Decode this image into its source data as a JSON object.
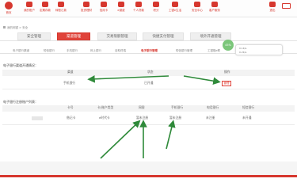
{
  "topnav": {
    "items": [
      {
        "label": "首页",
        "icon": "home-icon"
      },
      {
        "label": "我的账户",
        "icon": "account-icon"
      },
      {
        "label": "定期存款",
        "icon": "deposit-icon"
      },
      {
        "label": "转账汇款",
        "icon": "transfer-icon"
      },
      {
        "label": "投资理财",
        "icon": "invest-icon"
      },
      {
        "label": "信用卡",
        "icon": "card-icon"
      },
      {
        "label": "e缴费",
        "icon": "pay-icon"
      },
      {
        "label": "个人贷款",
        "icon": "loan-icon"
      },
      {
        "label": "积分",
        "icon": "points-icon"
      },
      {
        "label": "工银e生活",
        "icon": "life-icon"
      },
      {
        "label": "安全中心",
        "icon": "security-icon"
      },
      {
        "label": "客户服务",
        "icon": "service-icon"
      },
      {
        "label": "退出",
        "icon": "exit-icon"
      }
    ],
    "brand_color": "#d6372e"
  },
  "breadcrumb": "我的网银 > 安全",
  "tabs": [
    {
      "label": "安全管理",
      "active": false
    },
    {
      "label": "渠道管理",
      "active": true
    },
    {
      "label": "交易限额管理",
      "active": false
    },
    {
      "label": "快捷支付管理",
      "active": false
    },
    {
      "label": "境外开通管理",
      "active": false
    }
  ],
  "subtabs": [
    {
      "label": "电子银行渠道",
      "active": false
    },
    {
      "label": "短信银行",
      "active": false
    },
    {
      "label": "手机银行",
      "active": false
    },
    {
      "label": "网上银行",
      "active": false
    },
    {
      "label": "自助终端",
      "active": false
    },
    {
      "label": "电子银行管理",
      "active": true
    },
    {
      "label": "短信银行管理",
      "active": false
    },
    {
      "label": "工银融e联",
      "active": false
    }
  ],
  "badge_text": "45%",
  "tip_panel": {
    "line1": "0.1K/s",
    "line2": "0.2K/s"
  },
  "section1": {
    "title": "电子银行渠道开通情况：",
    "headers": [
      "渠道",
      "状态",
      "操作"
    ],
    "row": {
      "channel": "手机银行",
      "status": "已开通",
      "action": "管理"
    }
  },
  "section2": {
    "title": "电子银行注册账户列表：",
    "headers": [
      "卡号",
      "类别",
      "卡/账户类型",
      "网银",
      "手机银行",
      "电话银行",
      "短信银行"
    ],
    "row": {
      "card": "",
      "category": "借记卡",
      "type": "e时代卡",
      "ebank": "暂未注册",
      "mobile": "暂未注册",
      "phone": "未注册",
      "sms": "未开通"
    }
  },
  "colors": {
    "accent": "#e0433a",
    "arrow": "#2f8a3a"
  }
}
